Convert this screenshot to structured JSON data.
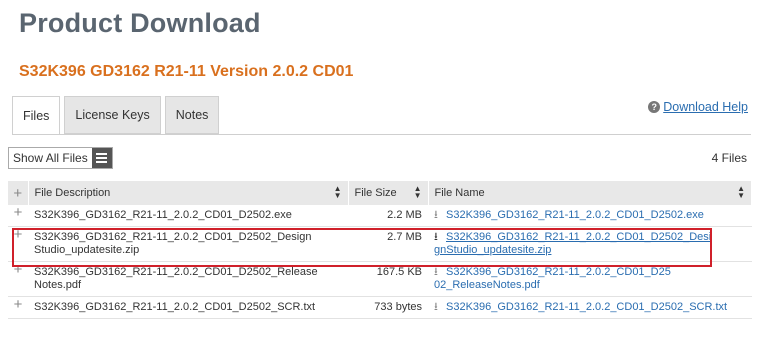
{
  "page": {
    "title": "Product Download",
    "subtitle": "S32K396 GD3162 R21-11 Version 2.0.2 CD01"
  },
  "tabs": [
    {
      "label": "Files",
      "active": true
    },
    {
      "label": "License Keys",
      "active": false
    },
    {
      "label": "Notes",
      "active": false
    }
  ],
  "help": {
    "icon": "question-circle-icon",
    "label": "Download Help"
  },
  "toolbar": {
    "show_all_label": "Show All Files",
    "menu_icon": "hamburger-menu-icon",
    "count": "4 Files"
  },
  "table": {
    "columns": {
      "expand": "+",
      "description": "File Description",
      "size": "File Size",
      "name": "File Name"
    },
    "rows": [
      {
        "description": "S32K396_GD3162_R21-11_2.0.2_CD01_D2502.exe",
        "size": "2.2 MB",
        "name": "S32K396_GD3162_R21-11_2.0.2_CD01_D2502.exe",
        "highlighted": false
      },
      {
        "description": "S32K396_GD3162_R21-11_2.0.2_CD01_D2502_DesignStudio_updatesite.zip",
        "size": "2.7 MB",
        "name": "S32K396_GD3162_R21-11_2.0.2_CD01_D2502_DesignStudio_updatesite.zip",
        "highlighted": true
      },
      {
        "description": "S32K396_GD3162_R21-11_2.0.2_CD01_D2502_ReleaseNotes.pdf",
        "size": "167.5 KB",
        "name": "S32K396_GD3162_R21-11_2.0.2_CD01_D2502_ReleaseNotes.pdf",
        "highlighted": false
      },
      {
        "description": "S32K396_GD3162_R21-11_2.0.2_CD01_D2502_SCR.txt",
        "size": "733 bytes",
        "name": "S32K396_GD3162_R21-11_2.0.2_CD01_D2502_SCR.txt",
        "highlighted": false
      }
    ]
  },
  "colors": {
    "title": "#5a6570",
    "subtitle": "#d9701e",
    "link": "#2a6db0",
    "highlight_border": "#d0202a"
  }
}
